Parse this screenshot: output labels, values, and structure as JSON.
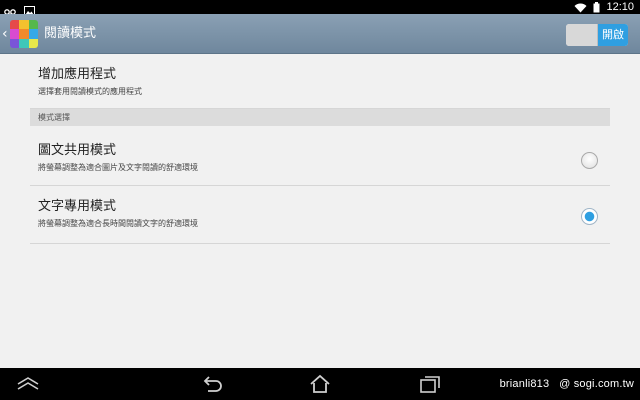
{
  "status_bar": {
    "time": "12:10"
  },
  "action_bar": {
    "title": "閱讀模式",
    "toggle_label": "開啟"
  },
  "preferences": {
    "add_apps": {
      "title": "增加應用程式",
      "summary": "選擇套用閱讀模式的應用程式"
    },
    "mode_category": "模式選擇",
    "modes": [
      {
        "title": "圖文共用模式",
        "summary": "將螢幕調整為適合圖片及文字閱讀的舒適環境",
        "checked": false
      },
      {
        "title": "文字專用模式",
        "summary": "將螢幕調整為適合長時間閱讀文字的舒適環境",
        "checked": true
      }
    ]
  },
  "watermark": {
    "user": "brianli813",
    "site": "@ sogi.com.tw"
  },
  "colors": {
    "action_bar": "#7b91a6",
    "accent": "#2f9fe1",
    "background": "#f1f1f1"
  }
}
